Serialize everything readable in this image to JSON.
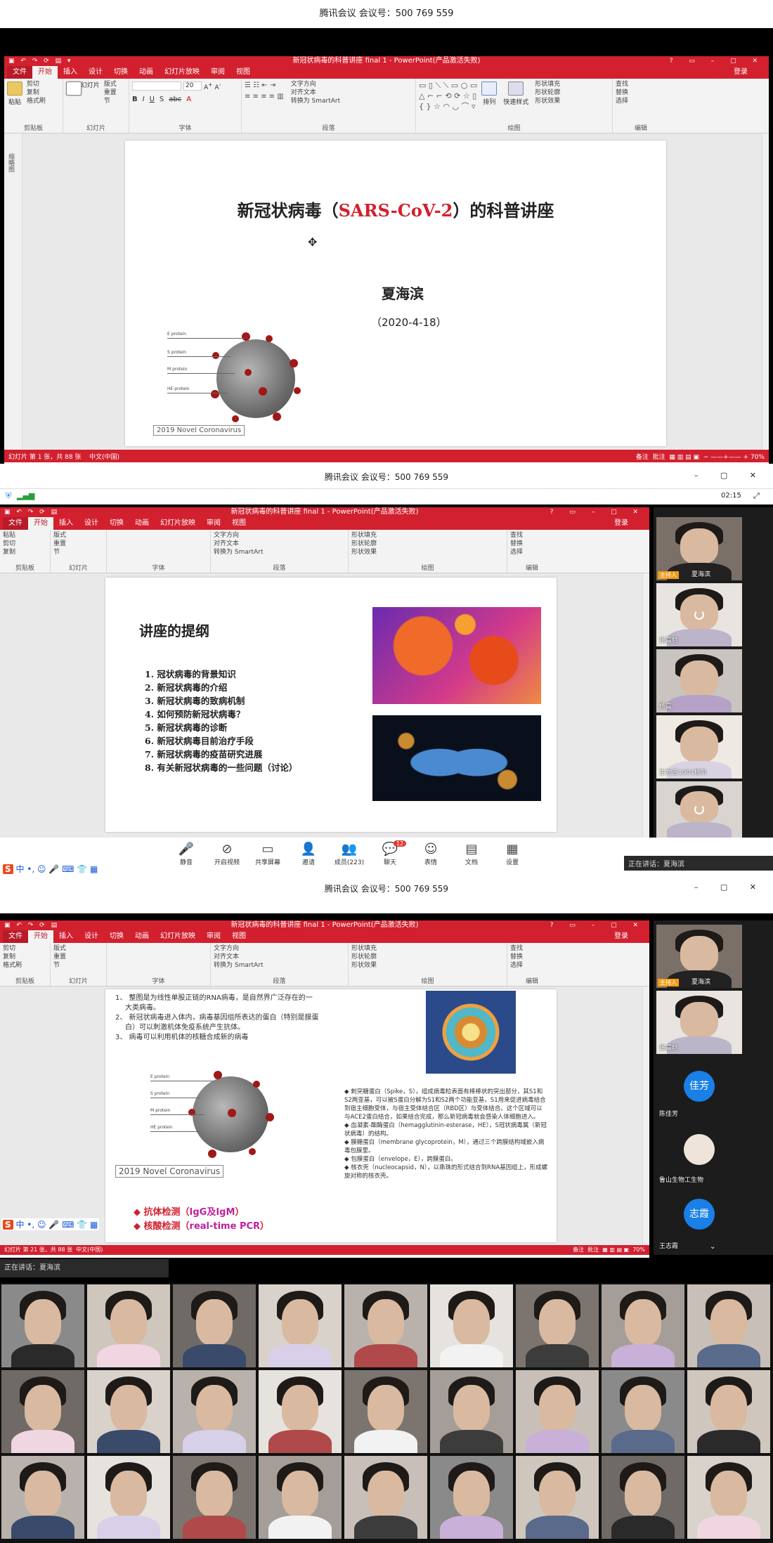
{
  "meeting": {
    "title": "腾讯会议 会议号：500 769 559"
  },
  "ppt": {
    "window_title": "新冠状病毒的科普讲座 final 1 - PowerPoint(产品激活失败)",
    "tabs": [
      "文件",
      "开始",
      "插入",
      "设计",
      "切换",
      "动画",
      "幻灯片放映",
      "审阅",
      "视图"
    ],
    "login": "登录",
    "groups": {
      "clipboard": "剪贴板",
      "slides": "幻灯片",
      "font": "字体",
      "paragraph": "段落",
      "drawing": "绘图",
      "editing": "编辑"
    },
    "clipboard": {
      "paste": "粘贴",
      "cut": "剪切",
      "copy": "复制",
      "format_painter": "格式刷"
    },
    "slides_group": {
      "new_slide": "新建\n幻灯片",
      "layout": "版式",
      "reset": "重置",
      "section": "节"
    },
    "font": {
      "size": "20",
      "bold": "B",
      "italic": "I",
      "underline": "U",
      "strike": "S",
      "abc": "abc"
    },
    "paragraph": {
      "text_dir": "文字方向",
      "align_text": "对齐文本",
      "smartart": "转换为 SmartArt"
    },
    "drawing": {
      "arrange": "排列",
      "quick_styles": "快速样式",
      "shape_fill": "形状填充",
      "shape_outline": "形状轮廓",
      "shape_effects": "形状效果"
    },
    "editing": {
      "find": "查找",
      "replace": "替换",
      "select": "选择"
    },
    "thumbnail_label": "缩略图",
    "status1": {
      "slide_info": "幻灯片 第 1 张，共 88 张",
      "lang": "中文(中国)",
      "notes": "备注",
      "comments": "批注",
      "zoom": "70%"
    },
    "status3": {
      "slide_info": "幻灯片 第 21 张，共 88 张",
      "lang": "中文(中国)",
      "notes": "备注",
      "comments": "批注",
      "zoom": "70%"
    }
  },
  "slide1": {
    "title_pre": "新冠状病毒（",
    "title_red": "SARS-CoV-2",
    "title_post": "）的科普讲座",
    "presenter": "夏海滨",
    "date": "（2020-4-18）",
    "virus_caption": "2019 Novel Coronavirus",
    "virus_labels": [
      "E protein",
      "S protein",
      "M protein",
      "HE protein"
    ]
  },
  "status_top": {
    "time": "02:15"
  },
  "slide2": {
    "heading": "讲座的提纲",
    "items": [
      "1. 冠状病毒的背景知识",
      "2. 新冠状病毒的介绍",
      "3. 新冠状病毒的致病机制",
      "4. 如何预防新冠状病毒？",
      "5. 新冠状病毒的诊断",
      "6. 新冠状病毒目前治疗手段",
      "7. 新冠状病毒的疫苗研究进展",
      "8. 有关新冠状病毒的一些问题（讨论）"
    ]
  },
  "meeting_toolbar": [
    {
      "label": "静音",
      "icon": "mic-icon"
    },
    {
      "label": "开启视频",
      "icon": "camera-off-icon"
    },
    {
      "label": "共享屏幕",
      "icon": "screen-share-icon"
    },
    {
      "label": "邀请",
      "icon": "invite-icon"
    },
    {
      "label": "成员(223)",
      "icon": "members-icon"
    },
    {
      "label": "聊天",
      "icon": "chat-icon",
      "badge": "12"
    },
    {
      "label": "表情",
      "icon": "emoji-icon"
    },
    {
      "label": "文档",
      "icon": "doc-icon"
    },
    {
      "label": "设置",
      "icon": "settings-icon"
    }
  ],
  "speaking": {
    "label": "正在讲话：夏海滨"
  },
  "participants_side2": [
    {
      "name": "夏海滨",
      "host": "主持人"
    },
    {
      "name": "张晨晗"
    },
    {
      "name": "杨晨"
    },
    {
      "name": "生物吉1904杨叭"
    },
    {
      "name": ""
    }
  ],
  "slide3": {
    "top_text": [
      "1、 整图是为线性单股正链的RNA病毒，是自然界广泛存在的一",
      "大类病毒。",
      "2、 新冠状病毒进入体内，病毒基因组所表达的蛋白（特别是膜蛋",
      "白）可以刺激机体免疫系统产生抗体。",
      "3、 病毒可以利用机体的核糖合成新的病毒"
    ],
    "bullets": [
      "◆ 刺突糖蛋白（Spike，S），组成病毒粒表面有棒棒状的突出部分，其S1和S2两亚基，可以被S蛋白分解为S1和S2两个功能亚基，S1用来促进病毒结合到宿主细胞受体，与宿主受体结合区（RBD区）与受体结合。这个区域可以与ACE2蛋白结合，如果结合完成，那么新冠病毒就会感染人体细胞进入。",
      "◆ 血凝素-酯酶蛋白（hemagglutinin-esterase，HE），S冠状病毒属（新冠状病毒）的结构。",
      "◆ 膜糖蛋白（membrane glycoprotein，M），通过三个跨膜结构域嵌入病毒包膜里。",
      "◆ 包膜蛋白（envelope，E），跨膜蛋白。",
      "◆ 核衣壳（nucleocapsid，N），以串珠的形式结合到RNA基因组上，形成螺旋对称的核衣壳。"
    ],
    "detect1_pre": "◆ 抗体检测（",
    "detect1_em": "IgG及IgM",
    "detect1_post": "）",
    "detect2_pre": "◆ 核酸检测（",
    "detect2_em": "real-time PCR",
    "detect2_post": "）",
    "virus_caption": "2019 Novel Coronavirus"
  },
  "participants_side3": [
    {
      "name": "夏海滨",
      "host": "主持人"
    },
    {
      "name": "张晨晗"
    },
    {
      "name": "佳芳",
      "avatar": "佳芳",
      "sub": "陈佳芳"
    },
    {
      "name": "鲁山生物工生物"
    },
    {
      "name": "志霞",
      "avatar": "志霞",
      "sub": "王志霞"
    }
  ],
  "speaking3": {
    "label": "正在讲话：夏海滨"
  }
}
